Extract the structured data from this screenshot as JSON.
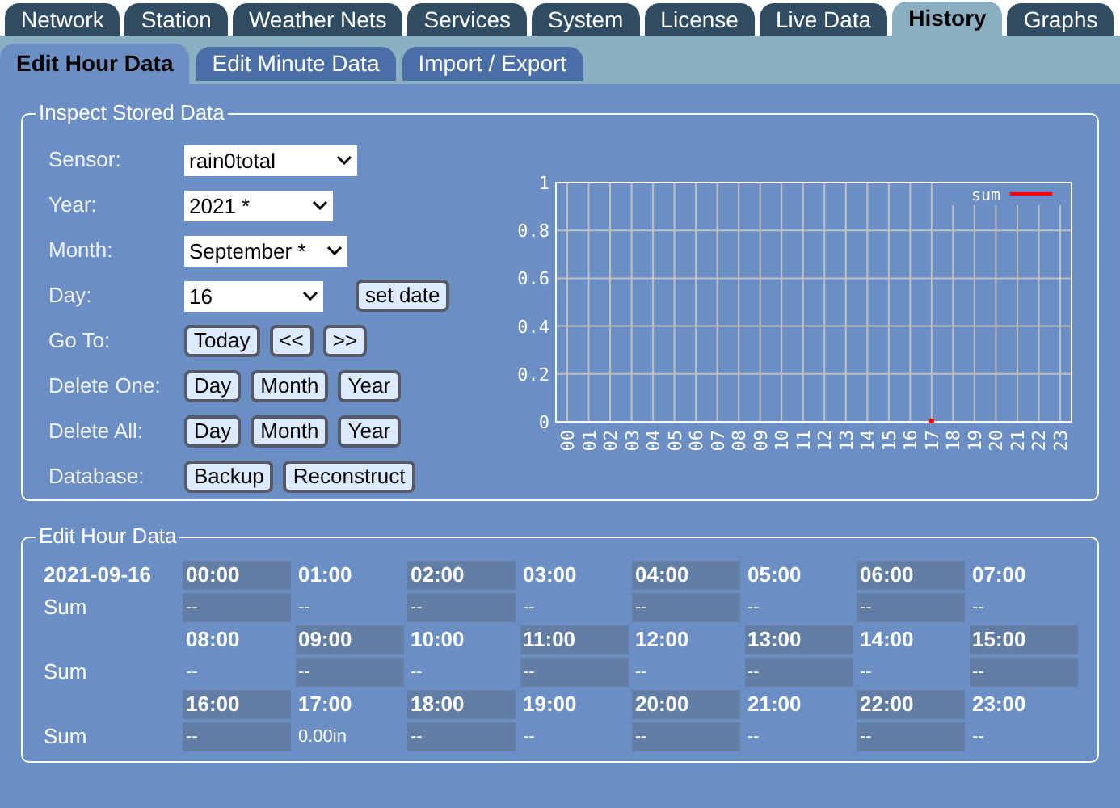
{
  "main_tabs": [
    {
      "label": "Network",
      "selected": false
    },
    {
      "label": "Station",
      "selected": false
    },
    {
      "label": "Weather Nets",
      "selected": false
    },
    {
      "label": "Services",
      "selected": false
    },
    {
      "label": "System",
      "selected": false
    },
    {
      "label": "License",
      "selected": false
    },
    {
      "label": "Live Data",
      "selected": false
    },
    {
      "label": "History",
      "selected": true
    },
    {
      "label": "Graphs",
      "selected": false
    }
  ],
  "sub_tabs": [
    {
      "label": "Edit Hour Data",
      "selected": true
    },
    {
      "label": "Edit Minute Data",
      "selected": false
    },
    {
      "label": "Import / Export",
      "selected": false
    }
  ],
  "inspect": {
    "legend": "Inspect Stored Data",
    "rows": [
      {
        "label": "Sensor:",
        "kind": "select",
        "value": "rain0total"
      },
      {
        "label": "Year:",
        "kind": "select",
        "value": "2021 *"
      },
      {
        "label": "Month:",
        "kind": "select",
        "value": "September *"
      },
      {
        "label": "Day:",
        "kind": "select",
        "value": "16",
        "buttons": [
          "set date"
        ]
      },
      {
        "label": "Go To:",
        "kind": "buttons",
        "buttons": [
          "Today",
          "<<",
          ">>"
        ]
      },
      {
        "label": "Delete One:",
        "kind": "buttons",
        "buttons": [
          "Day",
          "Month",
          "Year"
        ]
      },
      {
        "label": "Delete All:",
        "kind": "buttons",
        "buttons": [
          "Day",
          "Month",
          "Year"
        ]
      },
      {
        "label": "Database:",
        "kind": "buttons",
        "buttons": [
          "Backup",
          "Reconstruct"
        ]
      }
    ],
    "chart_data": {
      "type": "line",
      "categories": [
        "00",
        "01",
        "02",
        "03",
        "04",
        "05",
        "06",
        "07",
        "08",
        "09",
        "10",
        "11",
        "12",
        "13",
        "14",
        "15",
        "16",
        "17",
        "18",
        "19",
        "20",
        "21",
        "22",
        "23"
      ],
      "series": [
        {
          "name": "sum",
          "color": "#ff0000",
          "marker": "square",
          "values": [
            null,
            null,
            null,
            null,
            null,
            null,
            null,
            null,
            null,
            null,
            null,
            null,
            null,
            null,
            null,
            null,
            null,
            0,
            null,
            null,
            null,
            null,
            null,
            null
          ]
        }
      ],
      "grid": true,
      "ylim": [
        0,
        1
      ],
      "yticks": [
        0,
        0.2,
        0.4,
        0.6,
        0.8,
        1
      ]
    }
  },
  "hour_data": {
    "legend": "Edit Hour Data",
    "date": "2021-09-16",
    "groups": [
      {
        "label": "Sum",
        "hours": [
          {
            "time": "00:00",
            "value": "--"
          },
          {
            "time": "01:00",
            "value": "--"
          },
          {
            "time": "02:00",
            "value": "--"
          },
          {
            "time": "03:00",
            "value": "--"
          },
          {
            "time": "04:00",
            "value": "--"
          },
          {
            "time": "05:00",
            "value": "--"
          },
          {
            "time": "06:00",
            "value": "--"
          },
          {
            "time": "07:00",
            "value": "--"
          }
        ]
      },
      {
        "label": "Sum",
        "hours": [
          {
            "time": "08:00",
            "value": "--"
          },
          {
            "time": "09:00",
            "value": "--"
          },
          {
            "time": "10:00",
            "value": "--"
          },
          {
            "time": "11:00",
            "value": "--"
          },
          {
            "time": "12:00",
            "value": "--"
          },
          {
            "time": "13:00",
            "value": "--"
          },
          {
            "time": "14:00",
            "value": "--"
          },
          {
            "time": "15:00",
            "value": "--"
          }
        ]
      },
      {
        "label": "Sum",
        "hours": [
          {
            "time": "16:00",
            "value": "--"
          },
          {
            "time": "17:00",
            "value": "0.00in"
          },
          {
            "time": "18:00",
            "value": "--"
          },
          {
            "time": "19:00",
            "value": "--"
          },
          {
            "time": "20:00",
            "value": "--"
          },
          {
            "time": "21:00",
            "value": "--"
          },
          {
            "time": "22:00",
            "value": "--"
          },
          {
            "time": "23:00",
            "value": "--"
          }
        ]
      }
    ]
  }
}
